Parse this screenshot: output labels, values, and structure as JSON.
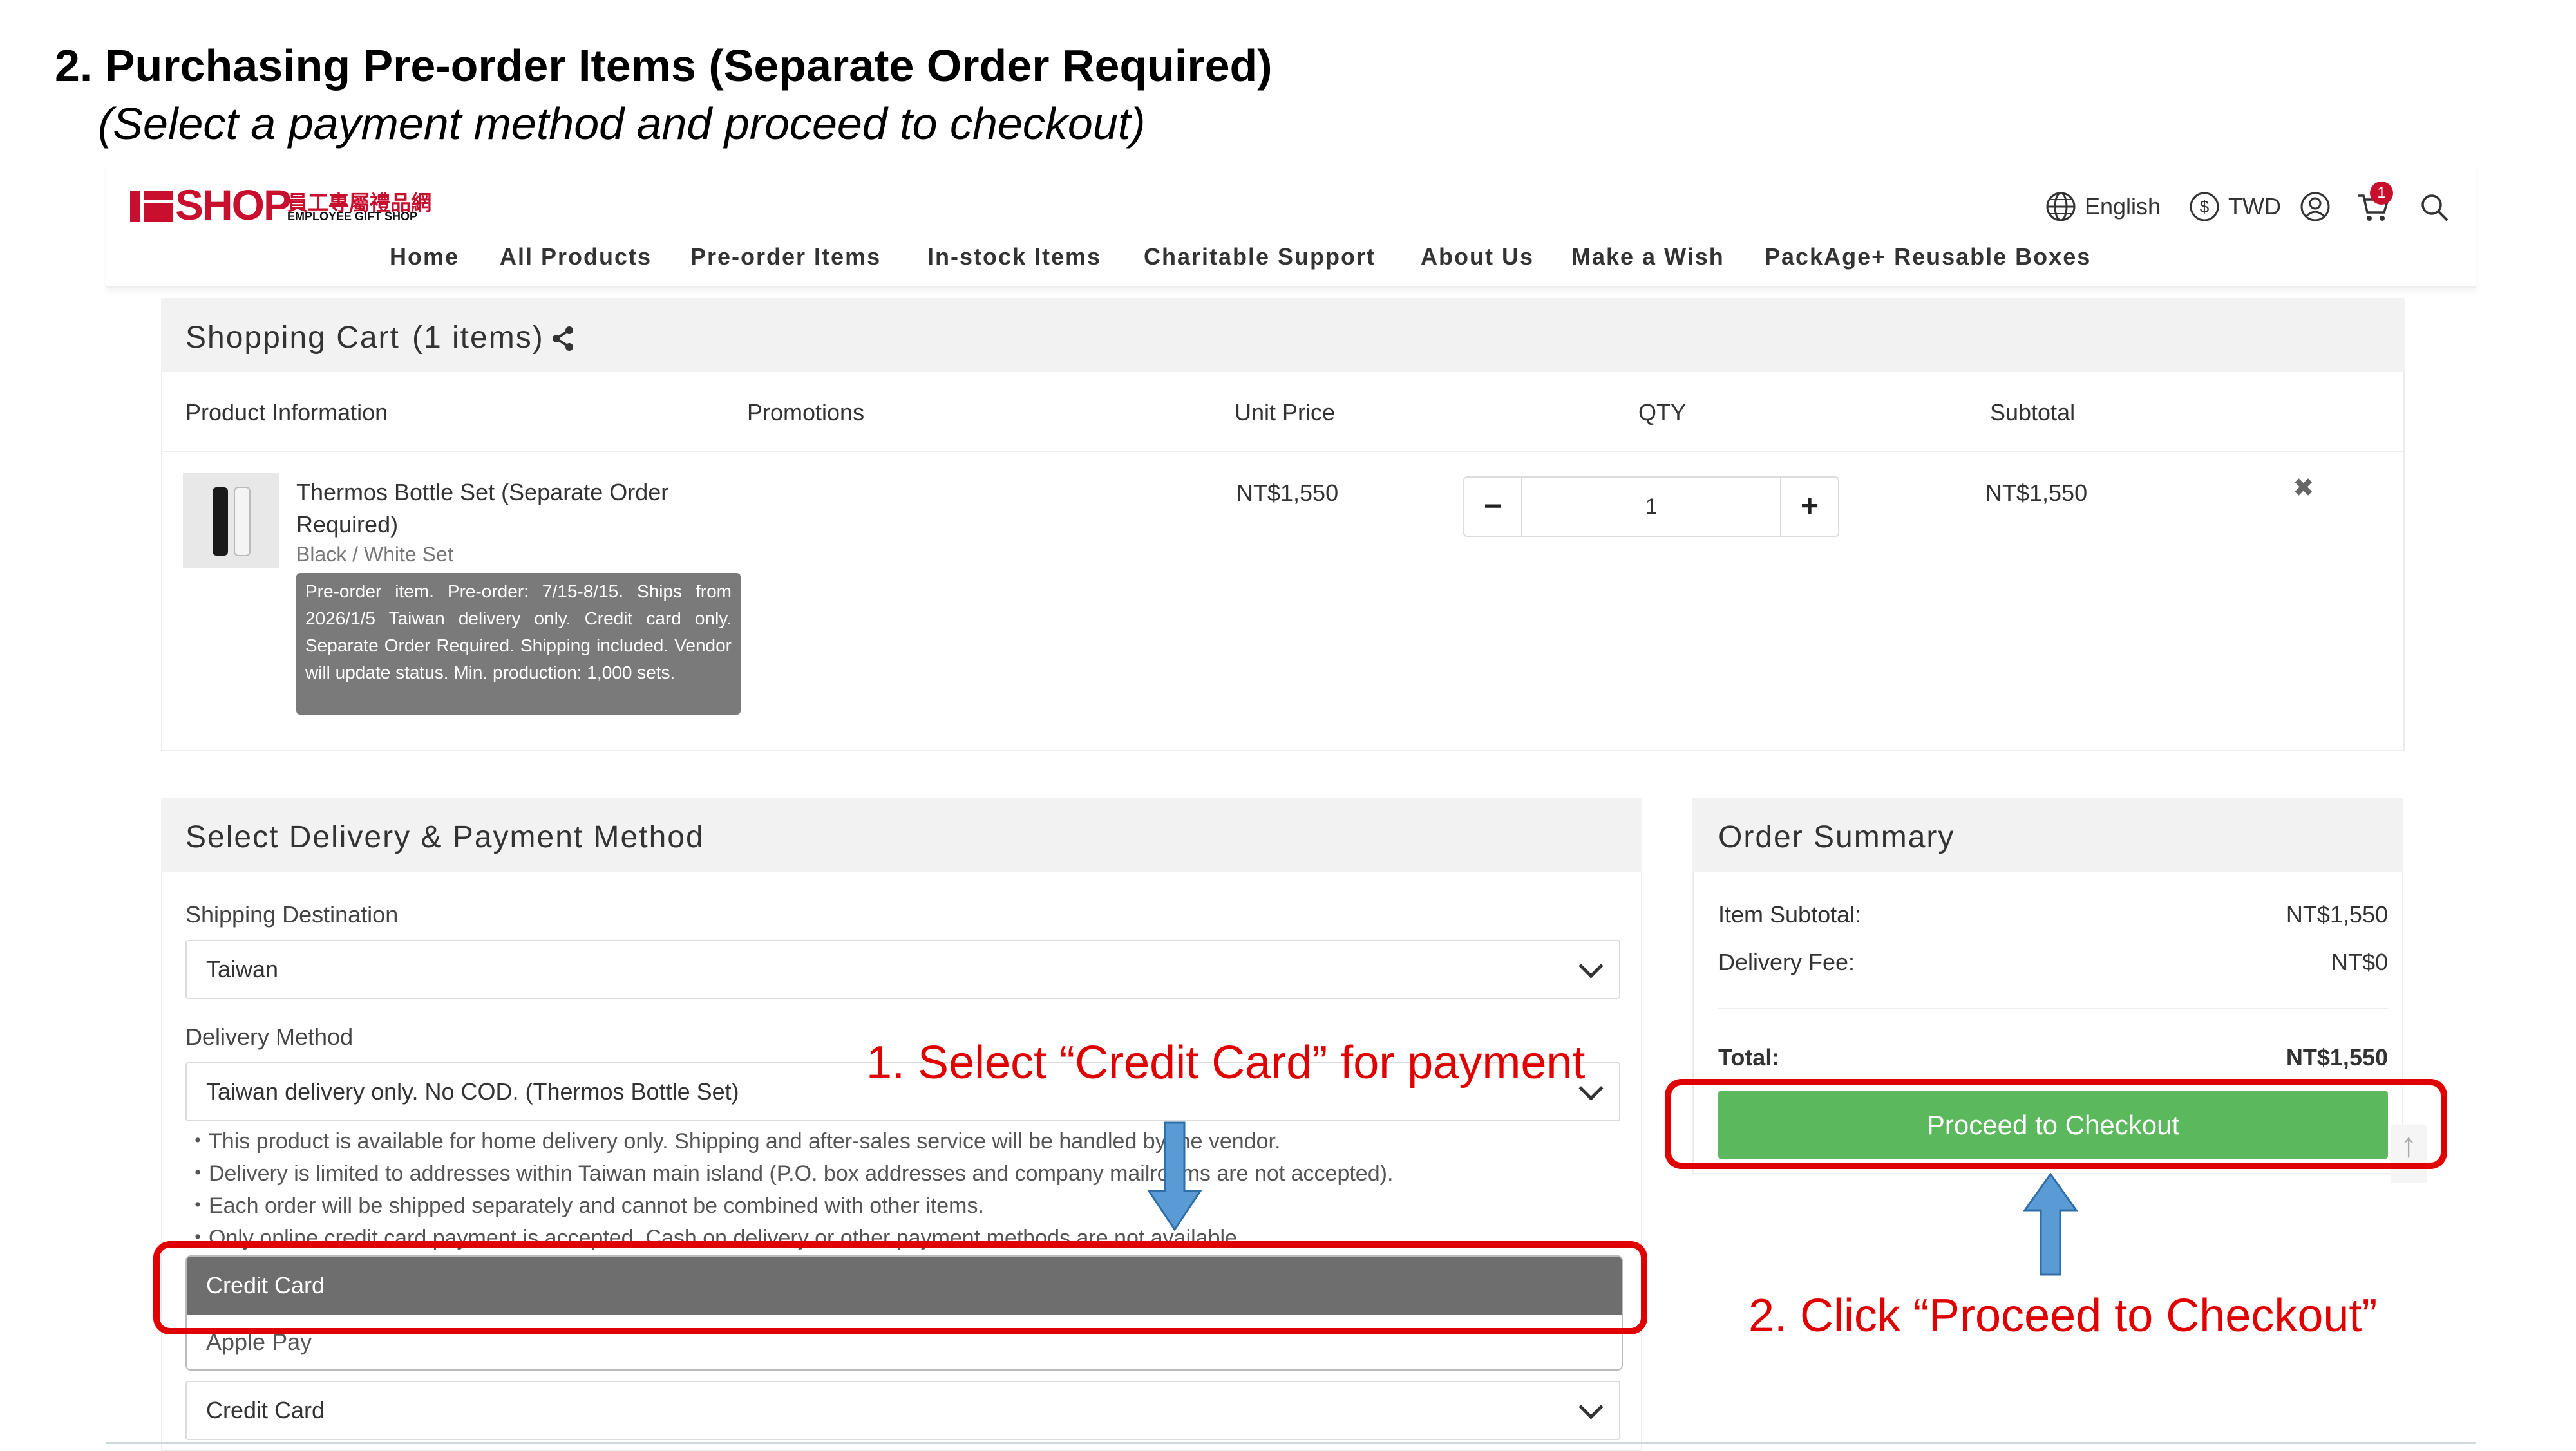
{
  "doc": {
    "title": "2. Purchasing Pre-order Items (Separate Order Required)",
    "subtitle": "(Select a payment method and proceed to checkout)"
  },
  "brand": {
    "logo_text": "SHOP",
    "logo_cn": "員工專屬禮品網",
    "logo_en": "EMPLOYEE GIFT SHOP",
    "color": "#c8102e"
  },
  "nav": [
    "Home",
    "All Products",
    "Pre-order Items",
    "In-stock Items",
    "Charitable Support",
    "About Us",
    "Make a Wish",
    "PackAge+ Reusable Boxes"
  ],
  "utility": {
    "language": "English",
    "currency": "TWD",
    "cart_count": "1",
    "icons": [
      "globe-icon",
      "currency-icon",
      "user-icon",
      "cart-icon",
      "search-icon"
    ]
  },
  "cart": {
    "title": "Shopping Cart",
    "count": "(1 items)",
    "columns": [
      "Product Information",
      "Promotions",
      "Unit Price",
      "QTY",
      "Subtotal"
    ],
    "item": {
      "name": "Thermos Bottle Set (Separate Order Required)",
      "variant": "Black / White Set",
      "note": "Pre-order item. Pre-order: 7/15-8/15. Ships from 2026/1/5 Taiwan delivery only. Credit card only. Separate Order Required. Shipping included. Vendor will update status. Min. production: 1,000 sets.",
      "unit_price": "NT$1,550",
      "qty": "1",
      "subtotal": "NT$1,550",
      "decrement": "−",
      "increment": "+",
      "remove": "✖"
    }
  },
  "delivery": {
    "title": "Select Delivery & Payment Method",
    "shipping_label": "Shipping Destination",
    "shipping_value": "Taiwan",
    "method_label": "Delivery Method",
    "method_value": "Taiwan delivery only. No COD. (Thermos Bottle Set)",
    "notes": [
      "・This product is available for home delivery only. Shipping and after-sales service will be handled by the vendor.",
      "・Delivery is limited to addresses within Taiwan main island (P.O. box addresses and company mailrooms are not accepted).",
      "・Each order will be shipped separately and cannot be combined with other items.",
      "・Only online credit card payment is accepted. Cash on delivery or other payment methods are not available."
    ],
    "payment_options": [
      "Credit Card",
      "Apple Pay"
    ],
    "payment_selected": "Credit Card"
  },
  "summary": {
    "title": "Order Summary",
    "item_subtotal_label": "Item Subtotal:",
    "item_subtotal": "NT$1,550",
    "delivery_fee_label": "Delivery Fee:",
    "delivery_fee": "NT$0",
    "total_label": "Total:",
    "total": "NT$1,550",
    "checkout_label": "Proceed to Checkout",
    "checkout_color": "#5cb85c"
  },
  "annotations": {
    "step1": "1.   Select “Credit Card” for payment",
    "step2": "2.   Click “Proceed to Checkout”",
    "highlight_color": "#e00000",
    "arrow_color": "#5b9bd5"
  }
}
